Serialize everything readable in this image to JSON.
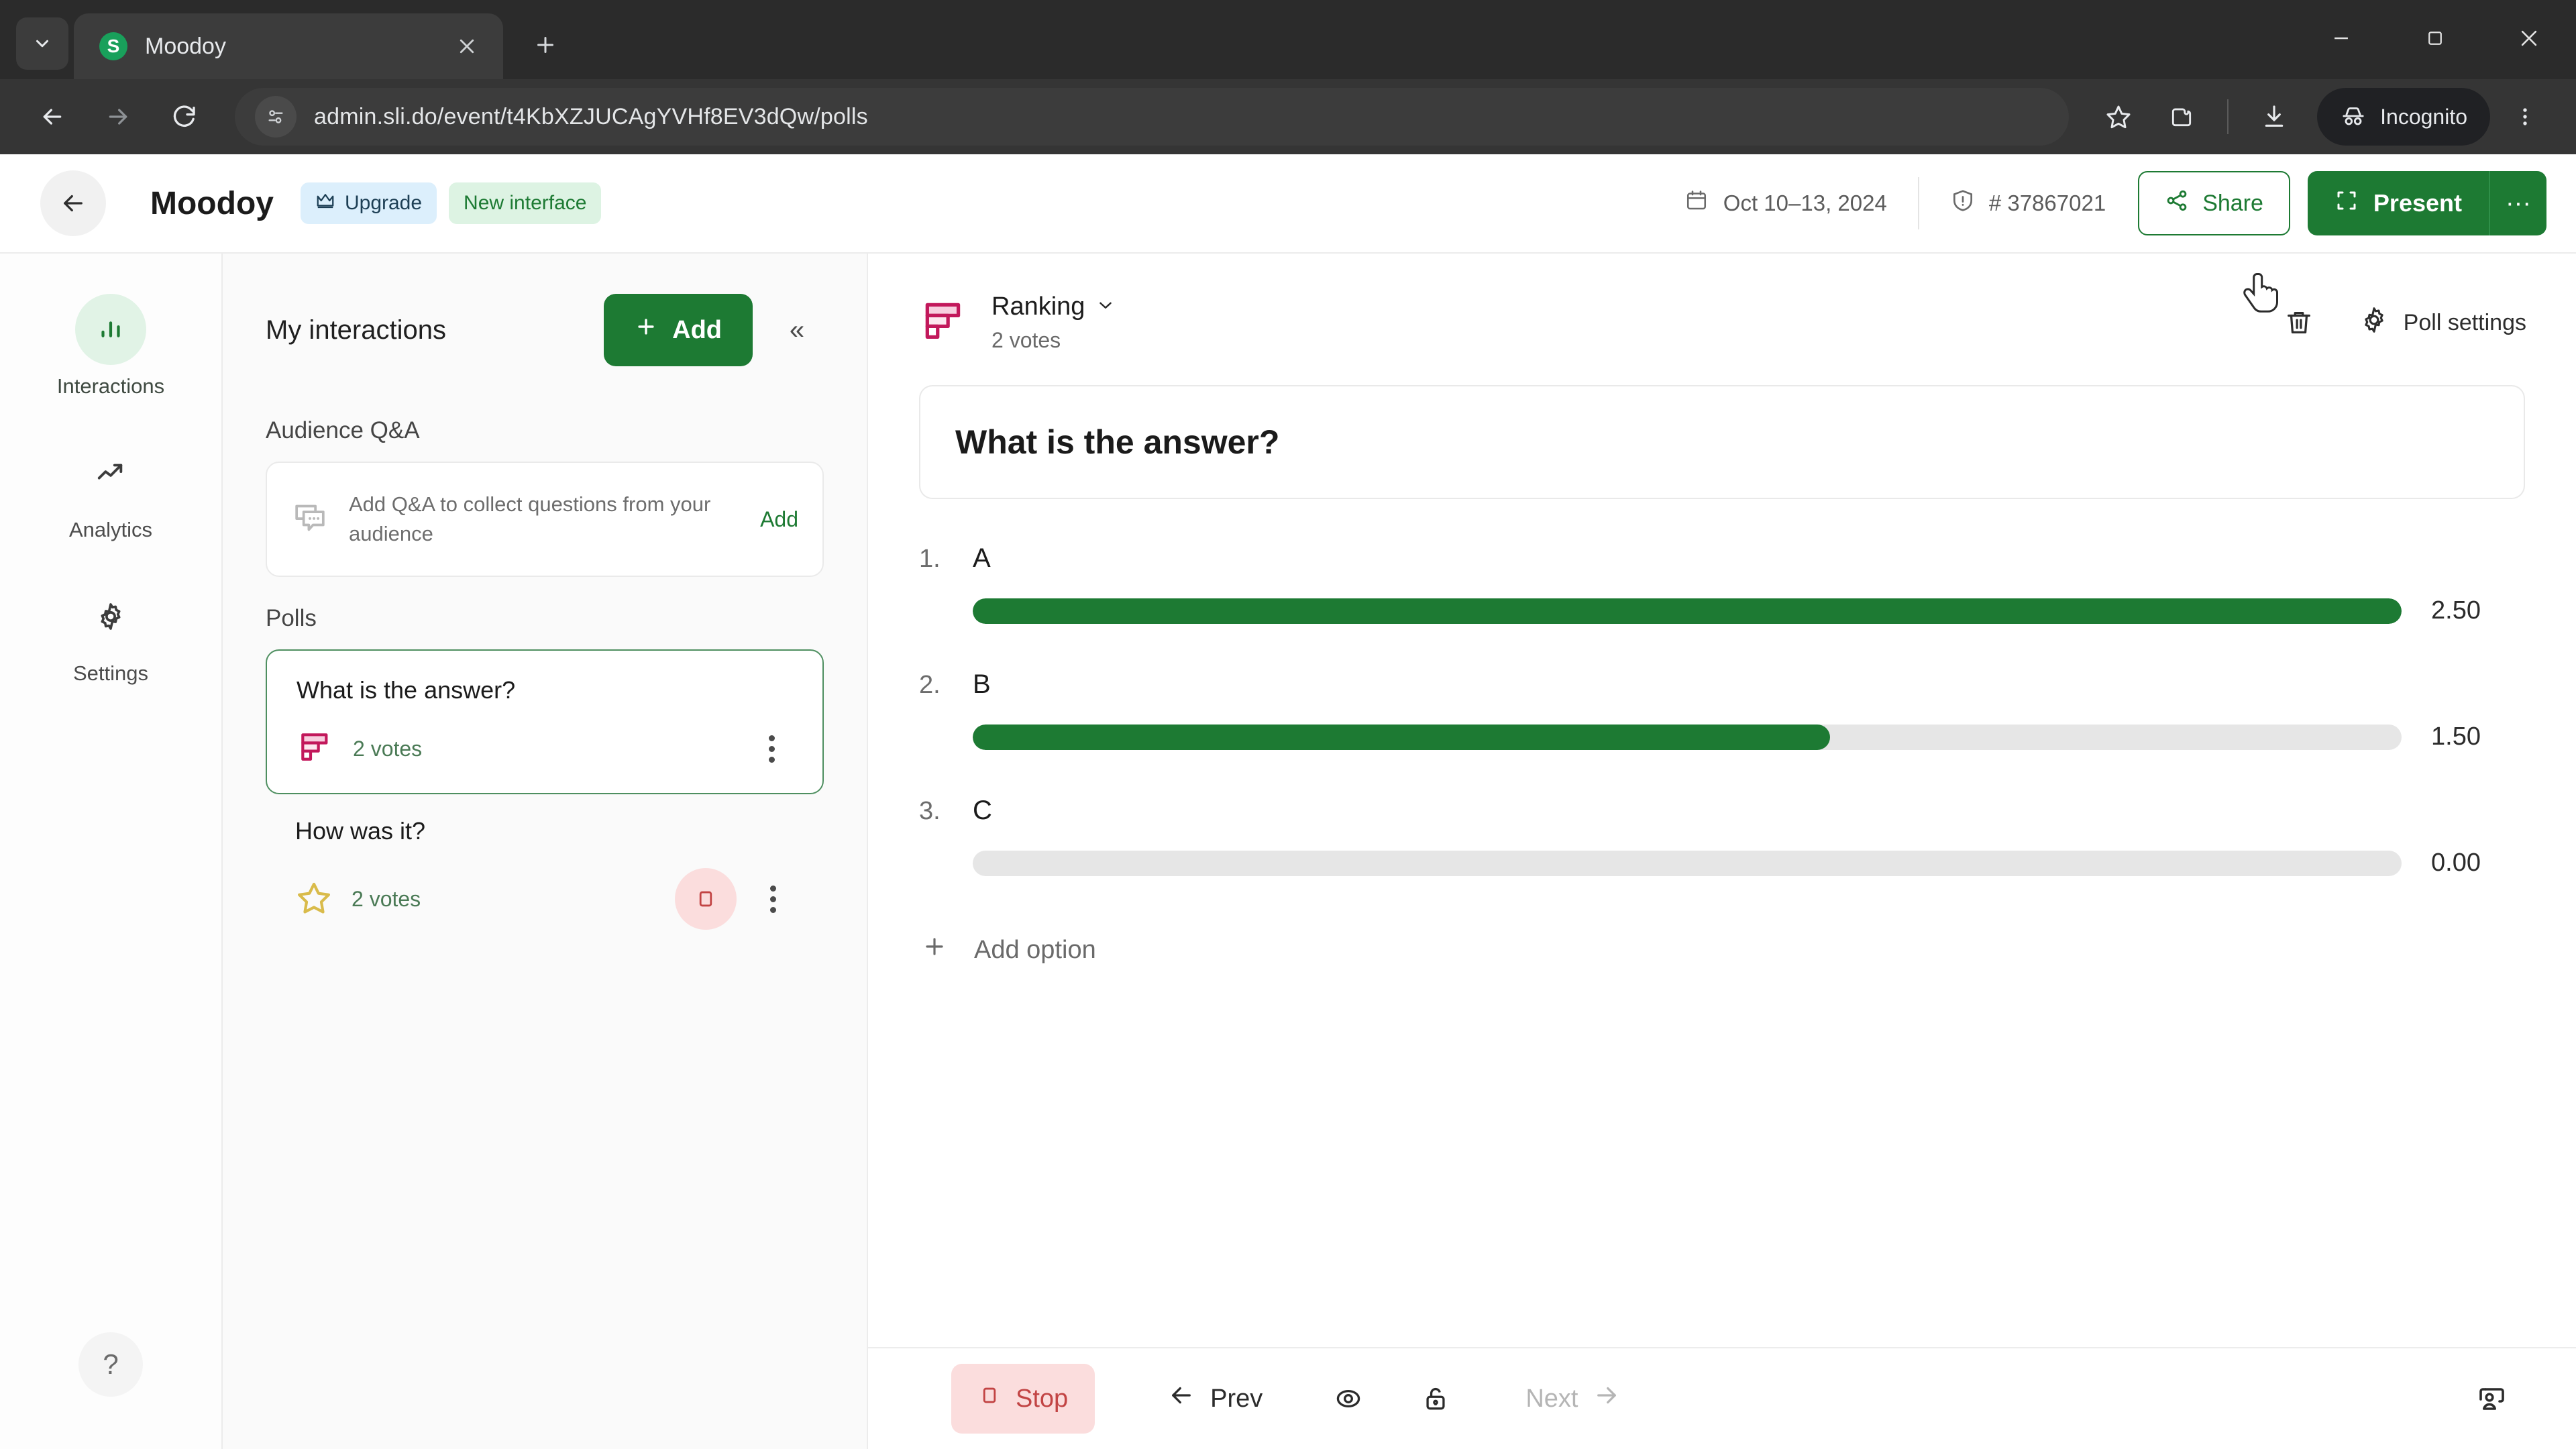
{
  "browser": {
    "tab": {
      "title": "Moodoy",
      "favicon_letter": "S",
      "favicon_name": "slido-favicon"
    },
    "new_tab_label": "+",
    "url": "admin.sli.do/event/t4KbXZJUCAgYVHf8EV3dQw/polls",
    "profile_label": "Incognito",
    "icons": {
      "tab_search": "chevron-down-icon",
      "back": "back-arrow-icon",
      "forward": "forward-arrow-icon",
      "reload": "reload-icon",
      "site_info": "site-settings-icon",
      "bookmark": "star-icon",
      "extensions": "extensions-icon",
      "downloads": "download-icon",
      "menu": "kebab-menu-icon",
      "minimize": "minimize-icon",
      "maximize": "maximize-icon",
      "close": "window-close-icon"
    }
  },
  "header": {
    "back_label": "←",
    "event_title": "Moodoy",
    "upgrade_label": "Upgrade",
    "new_interface_label": "New interface",
    "date_range": "Oct 10–13, 2024",
    "event_code": "# 37867021",
    "share_label": "Share",
    "present_label": "Present",
    "present_more_label": "···"
  },
  "rail": {
    "items": [
      {
        "label": "Interactions",
        "icon": "bar-chart-icon",
        "active": true
      },
      {
        "label": "Analytics",
        "icon": "trend-up-icon",
        "active": false
      },
      {
        "label": "Settings",
        "icon": "gear-icon",
        "active": false
      }
    ],
    "help_label": "?"
  },
  "panel": {
    "title": "My interactions",
    "add_label": "Add",
    "collapse_label": "«",
    "qa_section_label": "Audience Q&A",
    "qa_card_text": "Add Q&A to collect questions from your audience",
    "qa_card_add_label": "Add",
    "polls_section_label": "Polls",
    "polls": [
      {
        "title": "What is the answer?",
        "votes": "2 votes",
        "icon": "ranking-icon",
        "selected": true,
        "has_stop": false
      },
      {
        "title": "How was it?",
        "votes": "2 votes",
        "icon": "star-rating-icon",
        "selected": false,
        "has_stop": true
      }
    ]
  },
  "main": {
    "poll_type": "Ranking",
    "poll_votes": "2 votes",
    "delete_tooltip": "trash-icon",
    "poll_settings_label": "Poll settings",
    "question": "What is the answer?",
    "add_option_label": "Add option",
    "footer": {
      "stop_label": "Stop",
      "prev_label": "Prev",
      "next_label": "Next",
      "preview_icon": "eye-icon",
      "lock_icon": "unlock-icon",
      "speaker_icon": "speaker-view-icon"
    }
  },
  "chart_data": {
    "type": "bar",
    "title": "What is the answer?",
    "orientation": "horizontal",
    "categories": [
      "A",
      "B",
      "C"
    ],
    "values": [
      2.5,
      1.5,
      0.0
    ],
    "value_labels": [
      "2.50",
      "1.50",
      "0.00"
    ],
    "ranks": [
      "1.",
      "2.",
      "3."
    ],
    "xlabel": "",
    "ylabel": "",
    "xlim": [
      0,
      2.5
    ],
    "grid": false,
    "legend": false,
    "bar_color": "#1d7a33",
    "track_color": "#e6e6e6",
    "total_votes": "2 votes"
  },
  "colors": {
    "brand_green": "#1d7a33",
    "chip_blue_bg": "#dceffc",
    "chip_green_bg": "#ddf3e3",
    "stop_red_bg": "#fbdddd",
    "stop_red_fg": "#c24444",
    "ranking_pink": "#c2185b"
  }
}
